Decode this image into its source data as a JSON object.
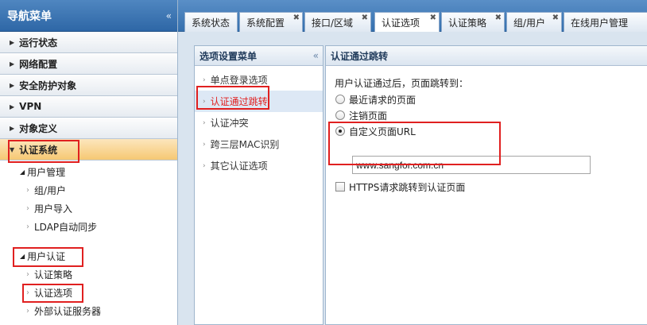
{
  "nav": {
    "title": "导航菜单",
    "collapse_glyph": "«",
    "sections": [
      {
        "label": "运行状态"
      },
      {
        "label": "网络配置"
      },
      {
        "label": "安全防护对象"
      },
      {
        "label": "VPN"
      },
      {
        "label": "对象定义"
      },
      {
        "label": "认证系统"
      }
    ],
    "user_mgmt": {
      "label": "用户管理",
      "items": [
        "组/用户",
        "用户导入",
        "LDAP自动同步"
      ]
    },
    "user_auth": {
      "label": "用户认证",
      "items": [
        "认证策略",
        "认证选项",
        "外部认证服务器"
      ]
    }
  },
  "tabs": [
    {
      "label": "系统状态",
      "closable": false
    },
    {
      "label": "系统配置",
      "closable": true
    },
    {
      "label": "接口/区域",
      "closable": true
    },
    {
      "label": "认证选项",
      "closable": true,
      "active": true
    },
    {
      "label": "认证策略",
      "closable": true
    },
    {
      "label": "组/用户",
      "closable": true
    },
    {
      "label": "在线用户管理",
      "closable": true
    }
  ],
  "sub_menu": {
    "title": "选项设置菜单",
    "collapse_glyph": "«",
    "items": [
      "单点登录选项",
      "认证通过跳转",
      "认证冲突",
      "跨三层MAC识别",
      "其它认证选项"
    ],
    "selected": "认证通过跳转"
  },
  "main": {
    "title": "认证通过跳转",
    "prompt": "用户认证通过后，页面跳转到：",
    "options": [
      "最近请求的页面",
      "注销页面",
      "自定义页面URL"
    ],
    "selected_option": "自定义页面URL",
    "url_value": "www.sangfor.com.cn",
    "https_checkbox_label": "HTTPS请求跳转到认证页面",
    "https_checked": false
  },
  "colors": {
    "accent_blue": "#3570ae",
    "highlight_red": "#e02020",
    "active_section": "#f6c873"
  }
}
